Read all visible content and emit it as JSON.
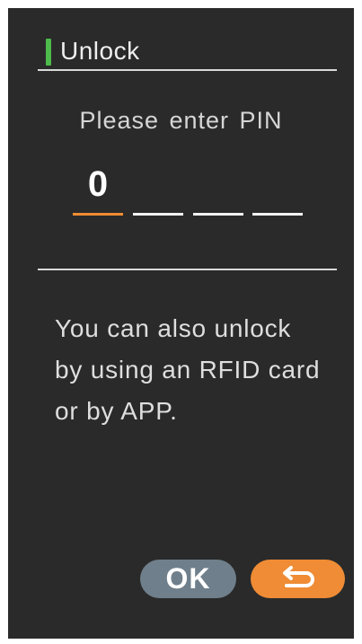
{
  "header": {
    "title": "Unlock",
    "accent_color": "#4cbb4b"
  },
  "pin": {
    "prompt": "Please enter PIN",
    "slots": [
      {
        "digit": "0",
        "active": true
      },
      {
        "digit": "",
        "active": false
      },
      {
        "digit": "",
        "active": false
      },
      {
        "digit": "",
        "active": false
      }
    ],
    "active_color": "#ee8c33"
  },
  "info": {
    "lines": [
      "You can also unlock",
      "by using an RFID card",
      "or by APP."
    ]
  },
  "buttons": {
    "ok_label": "OK",
    "ok_color": "#6f7f8b",
    "back_icon": "return-arrow-icon",
    "back_color": "#ef8c35"
  }
}
